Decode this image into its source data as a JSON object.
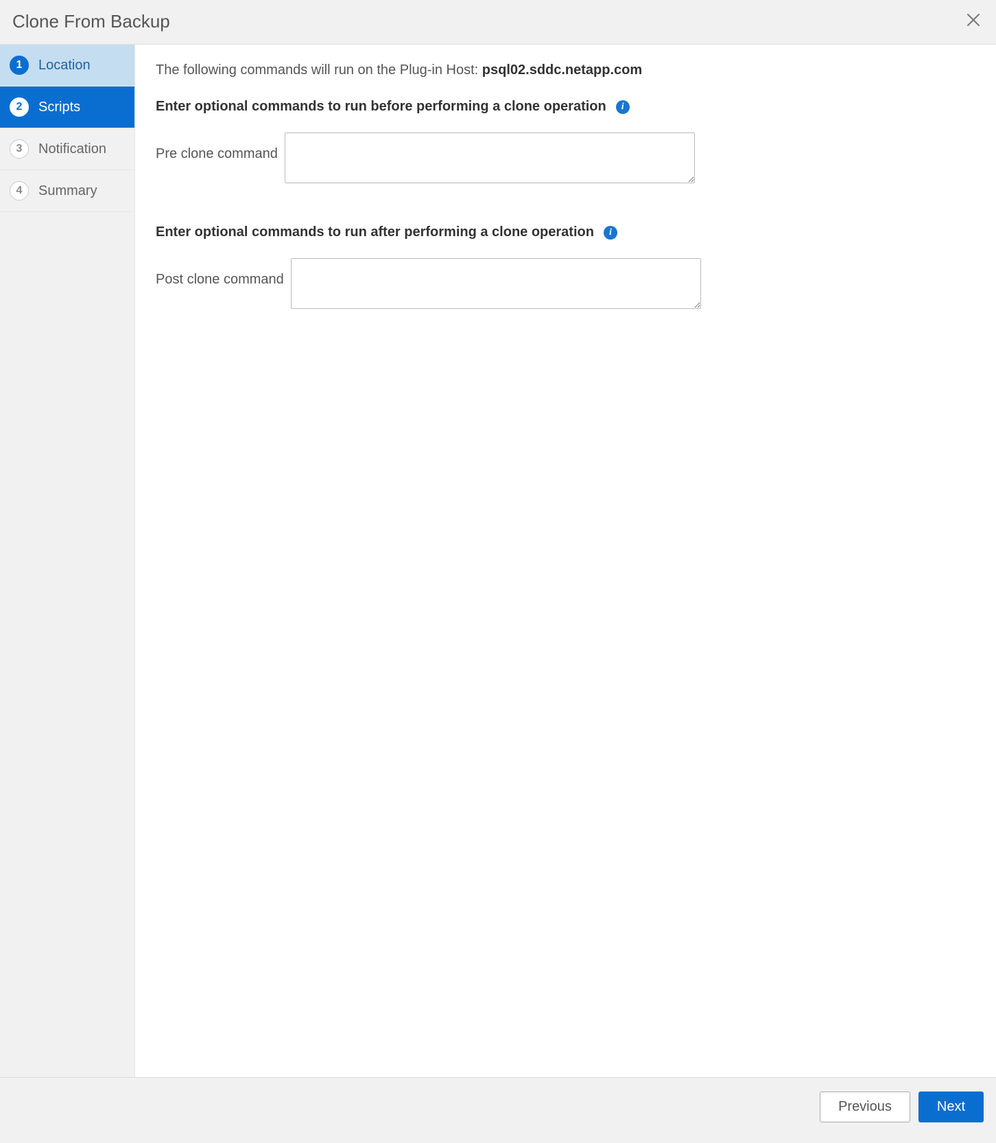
{
  "header": {
    "title": "Clone From Backup"
  },
  "sidebar": {
    "steps": [
      {
        "num": "1",
        "label": "Location",
        "state": "completed"
      },
      {
        "num": "2",
        "label": "Scripts",
        "state": "active"
      },
      {
        "num": "3",
        "label": "Notification",
        "state": "pending"
      },
      {
        "num": "4",
        "label": "Summary",
        "state": "pending"
      }
    ]
  },
  "content": {
    "intro_prefix": "The following commands will run on the Plug-in Host: ",
    "plugin_host": "psql02.sddc.netapp.com",
    "pre_section_title": "Enter optional commands to run before performing a clone operation",
    "pre_label": "Pre clone command",
    "pre_value": "",
    "post_section_title": "Enter optional commands to run after performing a clone operation",
    "post_label": "Post clone command",
    "post_value": ""
  },
  "footer": {
    "previous": "Previous",
    "next": "Next"
  }
}
